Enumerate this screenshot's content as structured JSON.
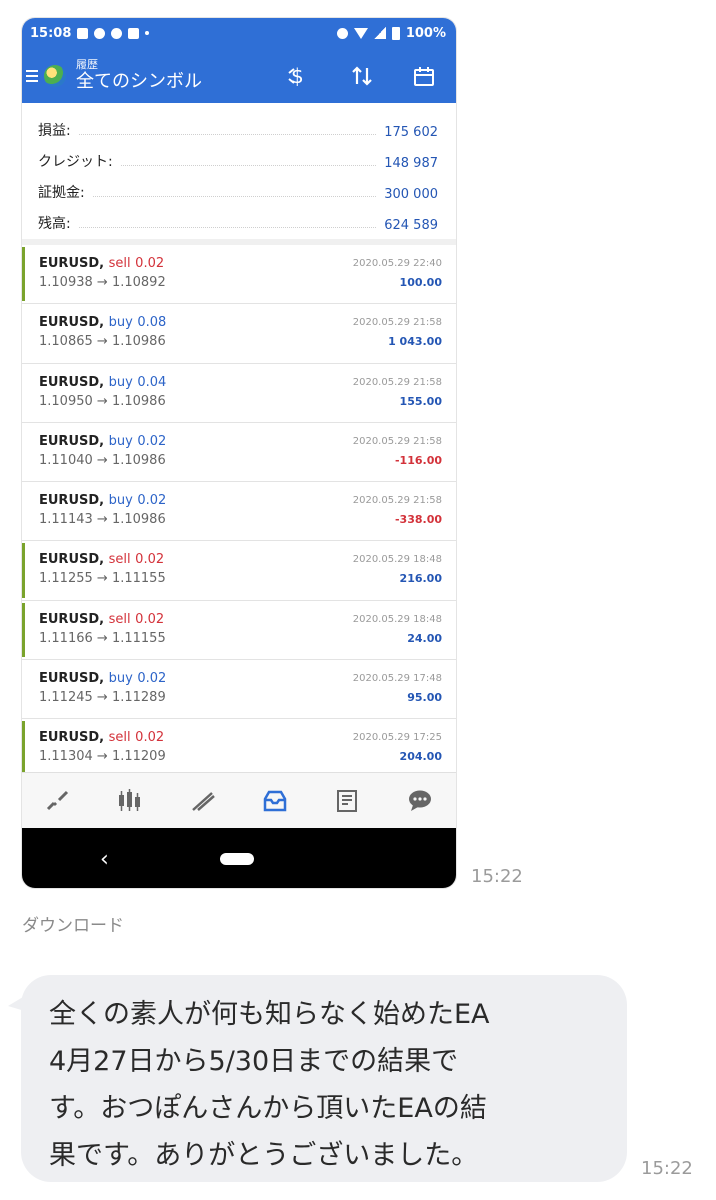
{
  "screenshot": {
    "status_bar": {
      "time": "15:08",
      "battery": "100%"
    },
    "app_bar": {
      "subtitle": "履歴",
      "title": "全てのシンボル"
    },
    "summary": [
      {
        "label": "損益:",
        "value": "175 602"
      },
      {
        "label": "クレジット:",
        "value": "148 987"
      },
      {
        "label": "証拠金:",
        "value": "300 000"
      },
      {
        "label": "残高:",
        "value": "624 589"
      }
    ],
    "trades": [
      {
        "symbol": "EURUSD,",
        "side": "sell",
        "lots": "0.02",
        "open": "1.10938",
        "close": "1.10892",
        "time": "2020.05.29 22:40",
        "profit": "100.00"
      },
      {
        "symbol": "EURUSD,",
        "side": "buy",
        "lots": "0.08",
        "open": "1.10865",
        "close": "1.10986",
        "time": "2020.05.29 21:58",
        "profit": "1 043.00"
      },
      {
        "symbol": "EURUSD,",
        "side": "buy",
        "lots": "0.04",
        "open": "1.10950",
        "close": "1.10986",
        "time": "2020.05.29 21:58",
        "profit": "155.00"
      },
      {
        "symbol": "EURUSD,",
        "side": "buy",
        "lots": "0.02",
        "open": "1.11040",
        "close": "1.10986",
        "time": "2020.05.29 21:58",
        "profit": "-116.00"
      },
      {
        "symbol": "EURUSD,",
        "side": "buy",
        "lots": "0.02",
        "open": "1.11143",
        "close": "1.10986",
        "time": "2020.05.29 21:58",
        "profit": "-338.00"
      },
      {
        "symbol": "EURUSD,",
        "side": "sell",
        "lots": "0.02",
        "open": "1.11255",
        "close": "1.11155",
        "time": "2020.05.29 18:48",
        "profit": "216.00"
      },
      {
        "symbol": "EURUSD,",
        "side": "sell",
        "lots": "0.02",
        "open": "1.11166",
        "close": "1.11155",
        "time": "2020.05.29 18:48",
        "profit": "24.00"
      },
      {
        "symbol": "EURUSD,",
        "side": "buy",
        "lots": "0.02",
        "open": "1.11245",
        "close": "1.11289",
        "time": "2020.05.29 17:48",
        "profit": "95.00"
      },
      {
        "symbol": "EURUSD,",
        "side": "sell",
        "lots": "0.02",
        "open": "1.11304",
        "close": "1.11209",
        "time": "2020.05.29 17:25",
        "profit": "204.00"
      }
    ],
    "arrow": "→",
    "nav_icons": [
      "quotes-icon",
      "chart-candles-icon",
      "trade-icon",
      "history-icon",
      "news-icon",
      "chat-icon"
    ]
  },
  "chat": {
    "image_time": "15:22",
    "download_label": "ダウンロード",
    "message": "全くの素人が何も知らなく始めたEA\n4月27日から5/30日までの結果で\nす。おつぽんさんから頂いたEAの結\n果です。ありがとうございました。",
    "message_time": "15:22"
  },
  "colors": {
    "app_blue": "#2f6fd6",
    "sell_red": "#d3323a",
    "buy_blue": "#2d64c8",
    "sell_marker": "#7aa32c",
    "bubble_bg": "#eeeff2"
  }
}
